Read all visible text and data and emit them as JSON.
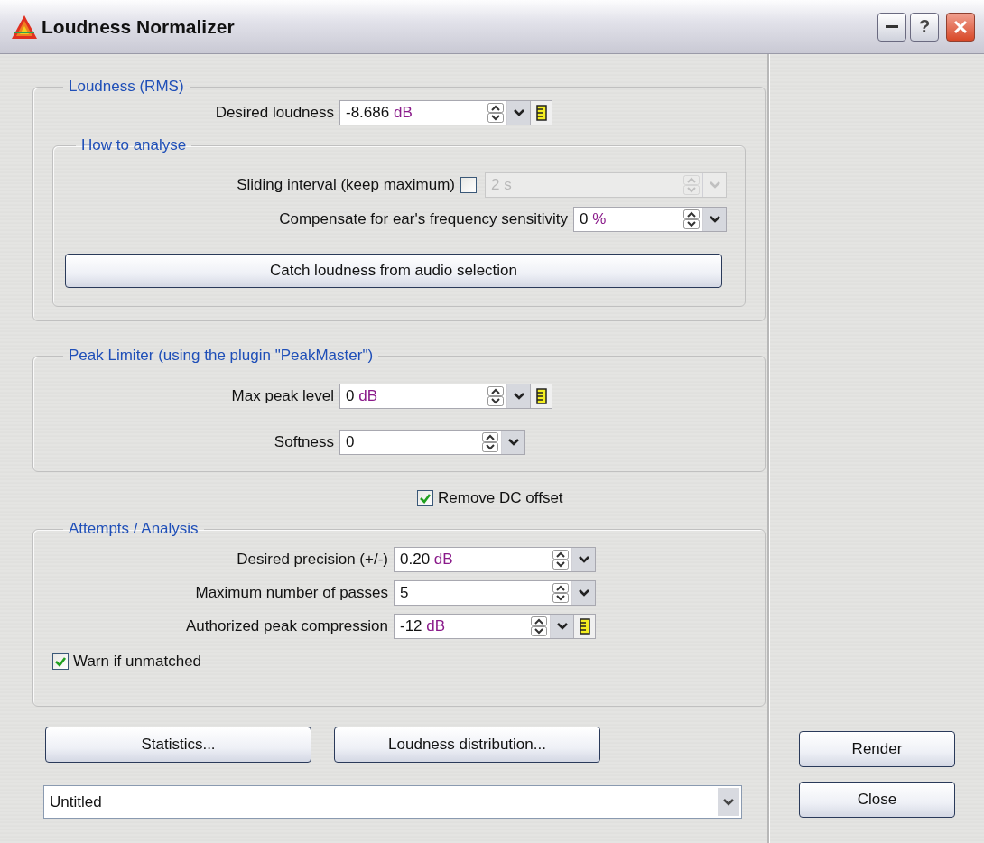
{
  "window": {
    "title": "Loudness Normalizer",
    "help_label": "?"
  },
  "sections": [
    {
      "kind": "group",
      "title": "Loudness (RMS)",
      "items": [
        {
          "kind": "field",
          "label": "Desired loudness",
          "value": "-8.686",
          "unit": "dB",
          "meter": true,
          "disabled": false
        },
        {
          "kind": "group",
          "title": "How to analyse",
          "items": [
            {
              "kind": "field",
              "label": "Sliding interval (keep maximum)",
              "checked": false,
              "value": "2",
              "unit": "s",
              "meter": false,
              "disabled": true
            },
            {
              "kind": "field",
              "label": "Compensate for ear's frequency sensitivity",
              "value": "0",
              "unit": "%",
              "meter": false,
              "disabled": false
            },
            {
              "kind": "button",
              "label": "Catch loudness from audio selection"
            }
          ]
        }
      ]
    },
    {
      "kind": "group",
      "title": "Peak Limiter (using the plugin \"PeakMaster\")",
      "items": [
        {
          "kind": "field",
          "label": "Max peak level",
          "value": "0",
          "unit": "dB",
          "meter": true,
          "disabled": false
        },
        {
          "kind": "field",
          "label": "Softness",
          "value": "0",
          "meter": false,
          "disabled": false
        }
      ]
    },
    {
      "kind": "checkbox",
      "label": "Remove DC offset",
      "checked": true
    },
    {
      "kind": "group",
      "title": "Attempts / Analysis",
      "items": [
        {
          "kind": "field",
          "label": "Desired precision (+/-)",
          "value": "0.20",
          "unit": "dB",
          "meter": false,
          "disabled": false
        },
        {
          "kind": "field",
          "label": "Maximum number of passes",
          "value": "5",
          "meter": false,
          "disabled": false
        },
        {
          "kind": "field",
          "label": "Authorized peak compression",
          "value": "-12",
          "unit": "dB",
          "meter": true,
          "disabled": false
        },
        {
          "kind": "checkbox",
          "label": "Warn if unmatched",
          "checked": true
        }
      ]
    }
  ],
  "buttons": [
    "Statistics...",
    "Loudness distribution..."
  ],
  "preset": {
    "value": "Untitled"
  },
  "side_buttons": [
    "Render",
    "Close"
  ]
}
